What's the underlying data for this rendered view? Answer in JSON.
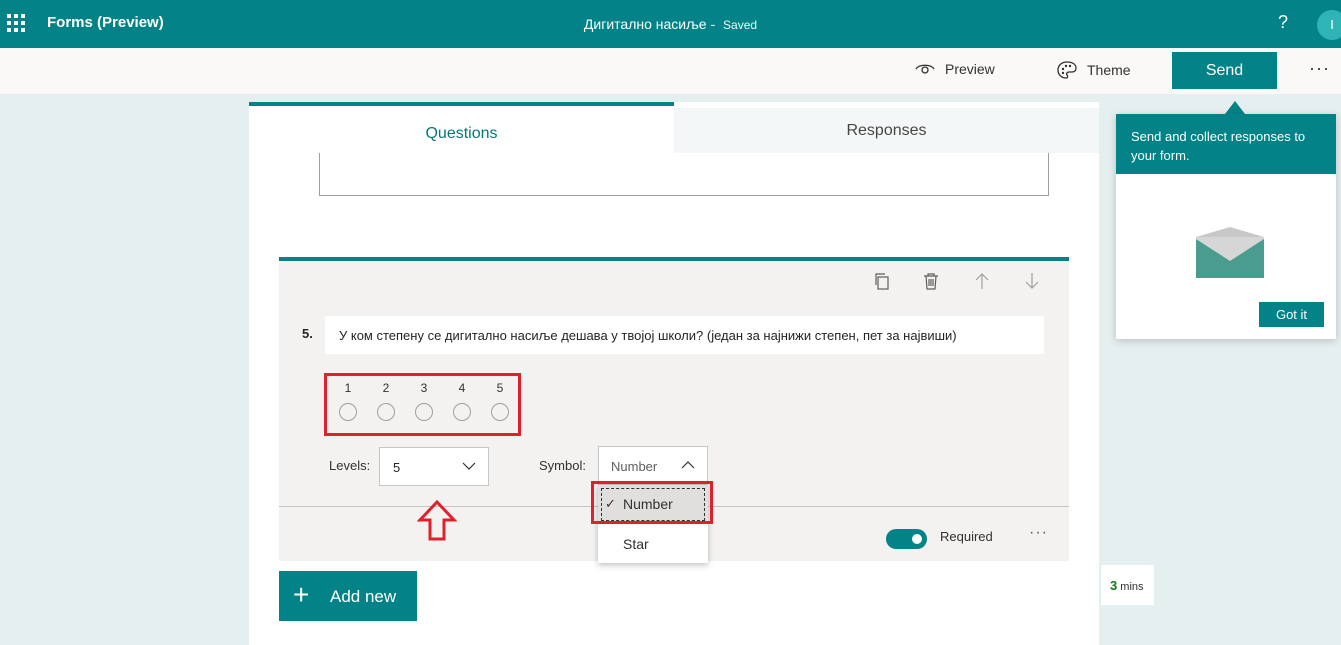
{
  "app": {
    "name": "Forms (Preview)",
    "doc_title": "Дигитално насиље",
    "separator": "-",
    "status": "Saved",
    "help": "?",
    "avatar_initial": "I"
  },
  "command_bar": {
    "preview": "Preview",
    "theme": "Theme",
    "send": "Send",
    "more": "···"
  },
  "tabs": [
    {
      "label": "Questions",
      "active": true
    },
    {
      "label": "Responses",
      "active": false
    }
  ],
  "question": {
    "number": "5.",
    "text": "У ком степену се дигитално насиље дешава у твојој школи? (један за најнижи степен, пет за највиши)",
    "rating_labels": [
      "1",
      "2",
      "3",
      "4",
      "5"
    ],
    "levels_label": "Levels:",
    "levels_value": "5",
    "symbol_label": "Symbol:",
    "symbol_value": "Number",
    "required_label": "Required",
    "required_on": true,
    "more": "···"
  },
  "symbol_dropdown": {
    "options": [
      "Number",
      "Star"
    ],
    "selected": "Number",
    "check": "✓"
  },
  "add_new": {
    "plus": "+",
    "label": "Add new"
  },
  "time_estimate": {
    "value": "3",
    "unit": "mins"
  },
  "callout": {
    "text": "Send and collect responses to your form.",
    "button": "Got it"
  },
  "colors": {
    "brand": "#038387",
    "highlight": "#e0202c",
    "required_green": "#107c10"
  }
}
